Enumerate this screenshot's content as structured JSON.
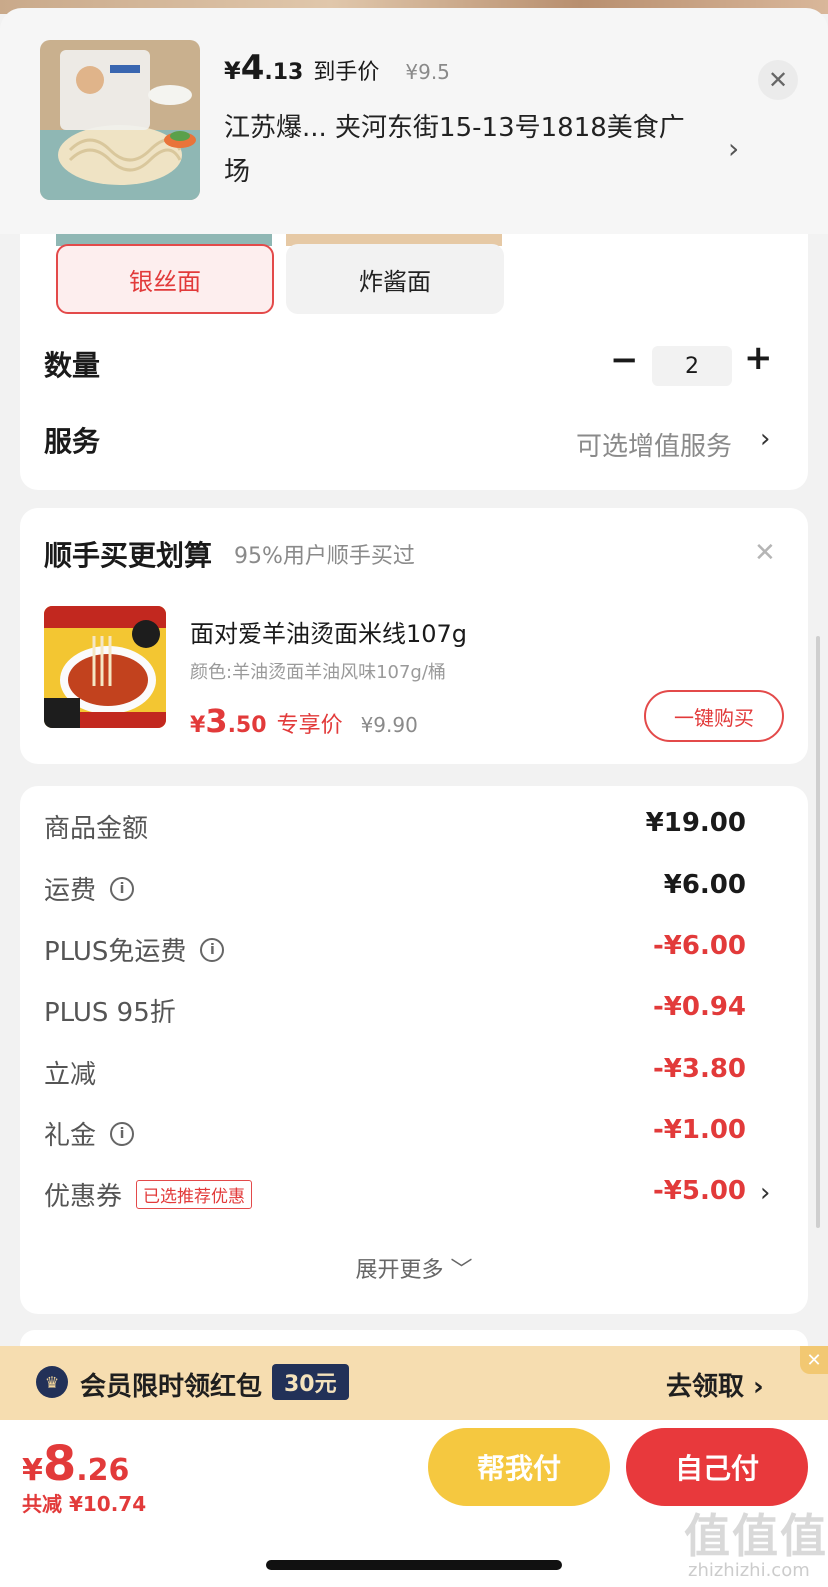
{
  "header": {
    "price_symbol": "¥",
    "price_int": "4",
    "price_dec": ".13",
    "price_tag": "到手价",
    "orig_price": "¥9.5",
    "address": "江苏爆... 夹河东街15-13号1818美食广场",
    "chevron": "›",
    "close": "✕"
  },
  "specs": [
    {
      "label": "银丝面",
      "selected": true
    },
    {
      "label": "炸酱面",
      "selected": false
    }
  ],
  "quantity": {
    "label": "数量",
    "value": "2",
    "minus": "−",
    "plus": "+"
  },
  "service": {
    "label": "服务",
    "hint": "可选增值服务",
    "chevron": "›"
  },
  "addon": {
    "title": "顺手买更划算",
    "subtitle": "95%用户顺手买过",
    "close": "✕",
    "product": {
      "name": "面对爱羊油烫面米线107g",
      "attr": "颜色:羊油烫面羊油风味107g/桶",
      "price_symbol": "¥",
      "price_int": "3",
      "price_dec": ".50",
      "price_tag": "专享价",
      "orig_price": "¥9.90",
      "buy_label": "一键购买"
    }
  },
  "breakdown": {
    "rows": [
      {
        "label": "商品金额",
        "value": "¥19.00",
        "info": false,
        "red": false
      },
      {
        "label": "运费",
        "value": "¥6.00",
        "info": true,
        "red": false
      },
      {
        "label": "PLUS免运费",
        "value": "-¥6.00",
        "info": true,
        "red": true
      },
      {
        "label": "PLUS 95折",
        "value": "-¥0.94",
        "info": false,
        "red": true
      },
      {
        "label": "立减",
        "value": "-¥3.80",
        "info": false,
        "red": true
      },
      {
        "label": "礼金",
        "value": "-¥1.00",
        "info": true,
        "red": true
      },
      {
        "label": "优惠券",
        "value": "-¥5.00",
        "info": false,
        "red": true,
        "badge": "已选推荐优惠"
      }
    ],
    "info_glyph": "i",
    "chevron": "›",
    "more_label": "展开更多 ﹀"
  },
  "banner": {
    "icon": "crown-icon",
    "crown_glyph": "♛",
    "text": "会员限时领红包",
    "amount": "30元",
    "go": "去领取 ›",
    "close": "✕"
  },
  "footer": {
    "total_symbol": "¥",
    "total_int": "8",
    "total_dec": ".26",
    "saved": "共减 ¥10.74",
    "help_pay": "帮我付",
    "self_pay": "自己付"
  },
  "watermark": {
    "main": "值值值",
    "sub": "zhizhizhi.com"
  },
  "colors": {
    "accent_red": "#e23a3a",
    "gold_button": "#f5c840",
    "pay_button": "#e8393c",
    "banner_bg": "#f6ddb0",
    "badge_navy": "#223158"
  }
}
